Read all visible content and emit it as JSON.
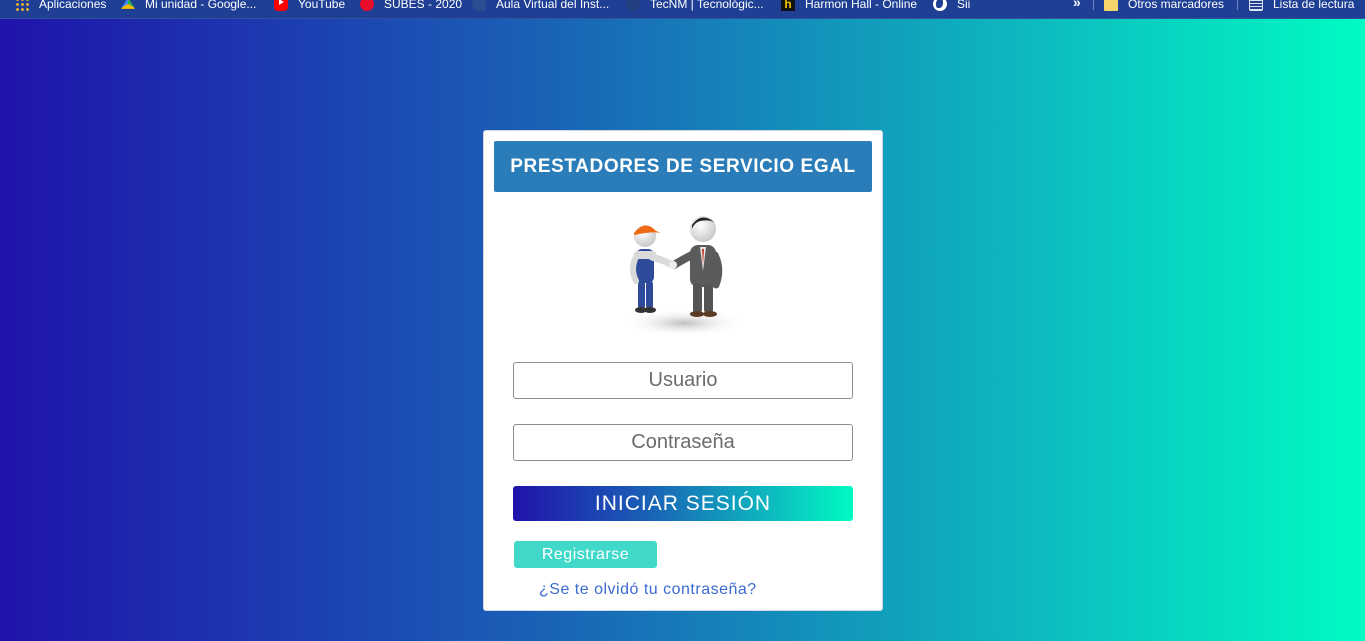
{
  "browser": {
    "bookmarks": [
      {
        "label": "Aplicaciones",
        "icon": "apps-grid-icon"
      },
      {
        "label": "Mi unidad - Google...",
        "icon": "google-drive-icon"
      },
      {
        "label": "YouTube",
        "icon": "youtube-icon"
      },
      {
        "label": "SUBES - 2020",
        "icon": "subes-icon"
      },
      {
        "label": "Aula Virtual del Inst...",
        "icon": "aula-virtual-icon"
      },
      {
        "label": "TecNM | Tecnológic...",
        "icon": "tecnm-icon"
      },
      {
        "label": "Harmon Hall - Online",
        "icon": "harmon-hall-icon"
      },
      {
        "label": "Sii",
        "icon": "globe-icon"
      }
    ],
    "overflow_label": "»",
    "other_bookmarks": {
      "label": "Otros marcadores",
      "icon": "folder-icon"
    },
    "reading_list": {
      "label": "Lista de lectura",
      "icon": "reading-list-icon"
    }
  },
  "login": {
    "title": "PRESTADORES DE SERVICIO EGAL",
    "illustration": "handshake-illustration",
    "username_placeholder": "Usuario",
    "password_placeholder": "Contraseña",
    "login_button": "INICIAR SESIÓN",
    "register_button": "Registrarse",
    "forgot_link": "¿Se te olvidó tu contraseña?"
  },
  "colors": {
    "gradient_start": "#1f13ab",
    "gradient_end": "#00fbc3",
    "header_blue": "#2a7db9",
    "register_teal": "#40d8c8",
    "link_blue": "#3b6bd0"
  }
}
